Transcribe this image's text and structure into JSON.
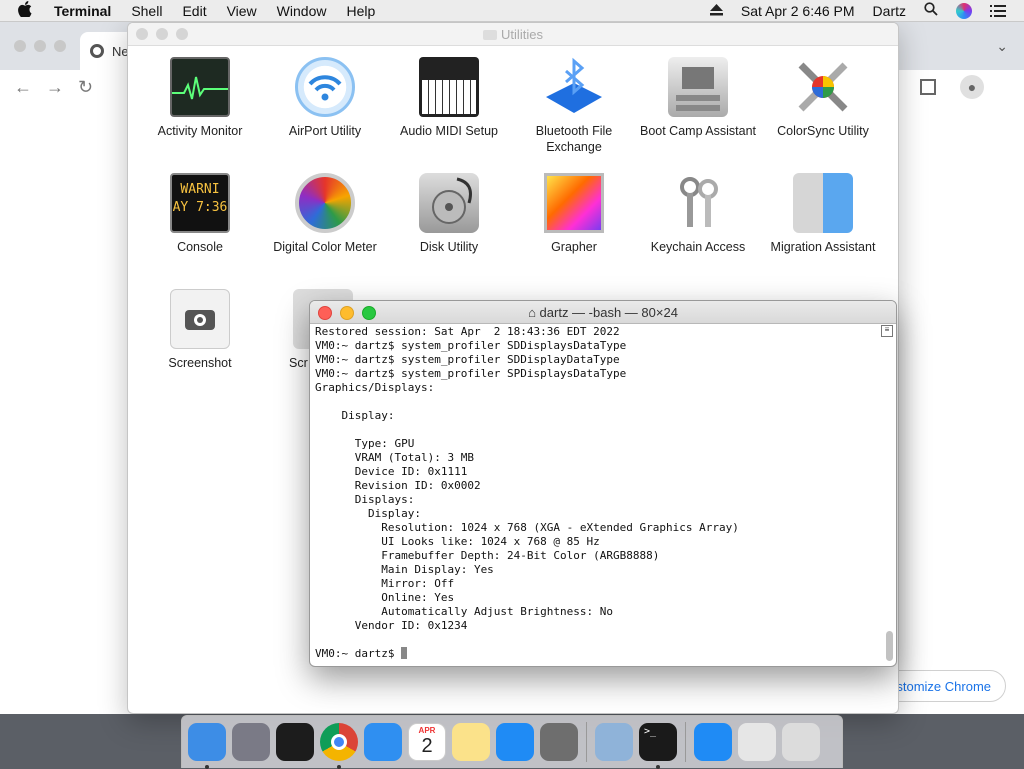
{
  "menubar": {
    "app": "Terminal",
    "items": [
      "Shell",
      "Edit",
      "View",
      "Window",
      "Help"
    ],
    "datetime": "Sat Apr 2  6:46 PM",
    "user": "Dartz"
  },
  "chrome": {
    "tab_title": "Ne",
    "customize_label": "stomize Chrome"
  },
  "finder": {
    "title": "Utilities",
    "apps": [
      {
        "label": "Activity Monitor",
        "icon": "activity-monitor-icon"
      },
      {
        "label": "AirPort Utility",
        "icon": "airport-utility-icon"
      },
      {
        "label": "Audio MIDI Setup",
        "icon": "audio-midi-icon"
      },
      {
        "label": "Bluetooth File Exchange",
        "icon": "bluetooth-icon"
      },
      {
        "label": "Boot Camp Assistant",
        "icon": "boot-camp-icon"
      },
      {
        "label": "ColorSync Utility",
        "icon": "colorsync-icon"
      },
      {
        "label": "Console",
        "icon": "console-icon"
      },
      {
        "label": "Digital Color Meter",
        "icon": "digital-color-meter-icon"
      },
      {
        "label": "Disk Utility",
        "icon": "disk-utility-icon"
      },
      {
        "label": "Grapher",
        "icon": "grapher-icon"
      },
      {
        "label": "Keychain Access",
        "icon": "keychain-icon"
      },
      {
        "label": "Migration Assistant",
        "icon": "migration-assistant-icon"
      },
      {
        "label": "Screenshot",
        "icon": "screenshot-icon"
      },
      {
        "label": "Scr",
        "icon": "script-editor-icon"
      }
    ],
    "console_icon_text": [
      "WARNI",
      "AY 7:36"
    ]
  },
  "terminal": {
    "title": "dartz — -bash — 80×24",
    "lines": [
      "Restored session: Sat Apr  2 18:43:36 EDT 2022",
      "VM0:~ dartz$ system_profiler SDDisplaysDataType",
      "VM0:~ dartz$ system_profiler SDDisplayDataType",
      "VM0:~ dartz$ system_profiler SPDisplaysDataType",
      "Graphics/Displays:",
      "",
      "    Display:",
      "",
      "      Type: GPU",
      "      VRAM (Total): 3 MB",
      "      Device ID: 0x1111",
      "      Revision ID: 0x0002",
      "      Displays:",
      "        Display:",
      "          Resolution: 1024 x 768 (XGA - eXtended Graphics Array)",
      "          UI Looks like: 1024 x 768 @ 85 Hz",
      "          Framebuffer Depth: 24-Bit Color (ARGB8888)",
      "          Main Display: Yes",
      "          Mirror: Off",
      "          Online: Yes",
      "          Automatically Adjust Brightness: No",
      "      Vendor ID: 0x1234",
      ""
    ],
    "prompt": "VM0:~ dartz$ "
  },
  "dock": {
    "items": [
      {
        "name": "finder-icon",
        "color": "#3d8de6",
        "running": true
      },
      {
        "name": "launchpad-icon",
        "color": "#7a7a86",
        "running": false
      },
      {
        "name": "davinci-icon",
        "color": "#1c1c1c",
        "running": false
      },
      {
        "name": "chrome-icon",
        "color": "#e8e8e8",
        "running": true
      },
      {
        "name": "safari-icon",
        "color": "#2f8ff1",
        "running": false
      },
      {
        "name": "calendar-icon",
        "color": "#ffffff",
        "running": false
      },
      {
        "name": "notes-icon",
        "color": "#fbe28a",
        "running": false
      },
      {
        "name": "app-store-icon",
        "color": "#1f8bf5",
        "running": false
      },
      {
        "name": "system-preferences-icon",
        "color": "#6e6e6e",
        "running": false
      },
      {
        "name": "preview-icon",
        "color": "#8fb3d9",
        "running": false
      },
      {
        "name": "terminal-icon",
        "color": "#1a1a1a",
        "running": true
      },
      {
        "name": "app-store-downloads-icon",
        "color": "#1f8bf5",
        "running": false
      },
      {
        "name": "documents-folder-icon",
        "color": "#e6e6e6",
        "running": false
      },
      {
        "name": "trash-icon",
        "color": "#dcdcdc",
        "running": false
      }
    ],
    "calendar": {
      "month": "APR",
      "day": "2"
    }
  }
}
